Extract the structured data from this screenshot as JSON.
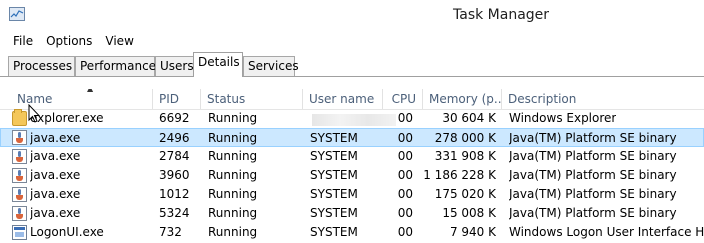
{
  "window": {
    "title": "Task Manager"
  },
  "menu": [
    "File",
    "Options",
    "View"
  ],
  "tabs": [
    "Processes",
    "Performance",
    "Users",
    "Details",
    "Services"
  ],
  "active_tab": "Details",
  "columns": [
    "Name",
    "PID",
    "Status",
    "User name",
    "CPU",
    "Memory (p...",
    "Description"
  ],
  "sort_indicator": "▲",
  "processes": [
    {
      "name": "explorer.exe",
      "pid": "6692",
      "status": "Running",
      "user": "",
      "cpu": "00",
      "memory": "30 604 K",
      "description": "Windows Explorer",
      "icon": "folder-icon"
    },
    {
      "name": "java.exe",
      "pid": "2496",
      "status": "Running",
      "user": "SYSTEM",
      "cpu": "00",
      "memory": "278 000 K",
      "description": "Java(TM) Platform SE binary",
      "icon": "java-icon"
    },
    {
      "name": "java.exe",
      "pid": "2784",
      "status": "Running",
      "user": "SYSTEM",
      "cpu": "00",
      "memory": "331 908 K",
      "description": "Java(TM) Platform SE binary",
      "icon": "java-icon"
    },
    {
      "name": "java.exe",
      "pid": "3960",
      "status": "Running",
      "user": "SYSTEM",
      "cpu": "00",
      "memory": "1 186 228 K",
      "description": "Java(TM) Platform SE binary",
      "icon": "java-icon"
    },
    {
      "name": "java.exe",
      "pid": "1012",
      "status": "Running",
      "user": "SYSTEM",
      "cpu": "00",
      "memory": "175 020 K",
      "description": "Java(TM) Platform SE binary",
      "icon": "java-icon"
    },
    {
      "name": "java.exe",
      "pid": "5324",
      "status": "Running",
      "user": "SYSTEM",
      "cpu": "00",
      "memory": "15 008 K",
      "description": "Java(TM) Platform SE binary",
      "icon": "java-icon"
    },
    {
      "name": "LogonUI.exe",
      "pid": "732",
      "status": "Running",
      "user": "SYSTEM",
      "cpu": "00",
      "memory": "7 940 K",
      "description": "Windows Logon User Interface Host",
      "icon": "logon-icon"
    }
  ],
  "selected_row": 1,
  "colors": {
    "selection_bg": "#cce8ff",
    "selection_border": "#99d1ff",
    "header_text": "#4c607a"
  }
}
